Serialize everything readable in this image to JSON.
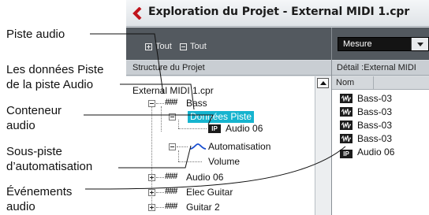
{
  "window": {
    "title": "Exploration du Projet - External MIDI 1.cpr"
  },
  "toolbar": {
    "expand_all": "Tout",
    "collapse_all": "Tout",
    "mode_select": "Mesure"
  },
  "left_panel": {
    "header": "Structure du Projet",
    "tree": {
      "root": "External MIDI 1.cpr",
      "bass": "Bass",
      "track_data": "Données Piste",
      "audio06_part": "Audio 06",
      "automation": "Automatisation",
      "volume": "Volume",
      "audio06_track": "Audio 06",
      "elec_guitar": "Elec Guitar",
      "guitar2": "Guitar 2"
    }
  },
  "right_panel": {
    "header": "Détail :External MIDI",
    "column_name": "Nom",
    "items": [
      "Bass-03",
      "Bass-03",
      "Bass-03",
      "Bass-03",
      "Audio 06"
    ]
  },
  "callouts": {
    "audio_track": "Piste audio",
    "track_data_line1": "Les données Piste",
    "track_data_line2": "de la piste Audio",
    "container_line1": "Conteneur",
    "container_line2": "audio",
    "subtrack_line1": "Sous-piste",
    "subtrack_line2": "d’automatisation",
    "events_line1": "Événements",
    "events_line2": "audio"
  },
  "icons": {
    "part_icon_text": "IP"
  },
  "colors": {
    "selection": "#16b4cf",
    "toolbar": "#53595f"
  }
}
